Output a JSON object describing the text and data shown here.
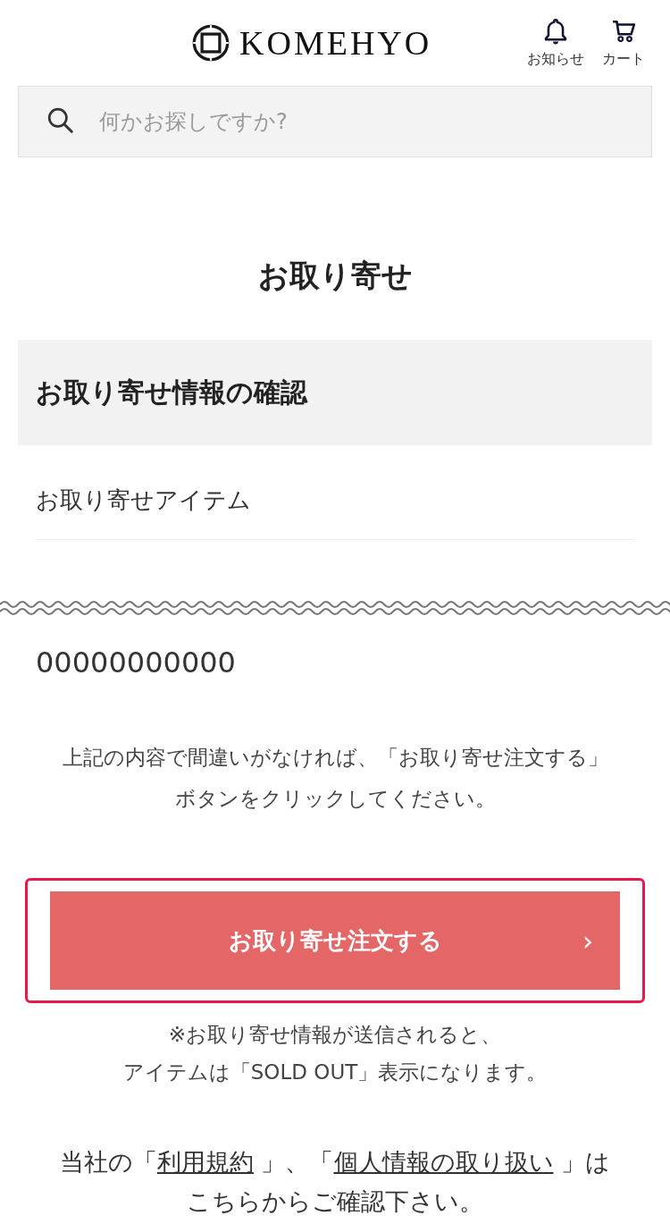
{
  "header": {
    "logo": "KOMEHYO",
    "actions": [
      {
        "kind": "bell",
        "label": "お知らせ"
      },
      {
        "kind": "cart",
        "label": "カート"
      }
    ]
  },
  "search": {
    "placeholder": "何かお探しですか?"
  },
  "page_title": "お取り寄せ",
  "section": {
    "heading": "お取り寄せ情報の確認",
    "item_label": "お取り寄せアイテム"
  },
  "order_number": "00000000000",
  "instruction": "上記の内容で間違いがなければ、「お取り寄せ注文する」ボタンをクリックしてください。",
  "submit_button": {
    "label": "お取り寄せ注文する",
    "icon": "›"
  },
  "notice": [
    "※お取り寄せ情報が送信されると、",
    "アイテムは「SOLD OUT」表示になります。"
  ],
  "terms": {
    "prefix": "当社の「",
    "link_1": "利用規約",
    "middle": " 」、「",
    "link_2": "個人情報の取り扱い",
    "suffix": " 」は",
    "line_2": "こちらからご確認下さい。"
  }
}
